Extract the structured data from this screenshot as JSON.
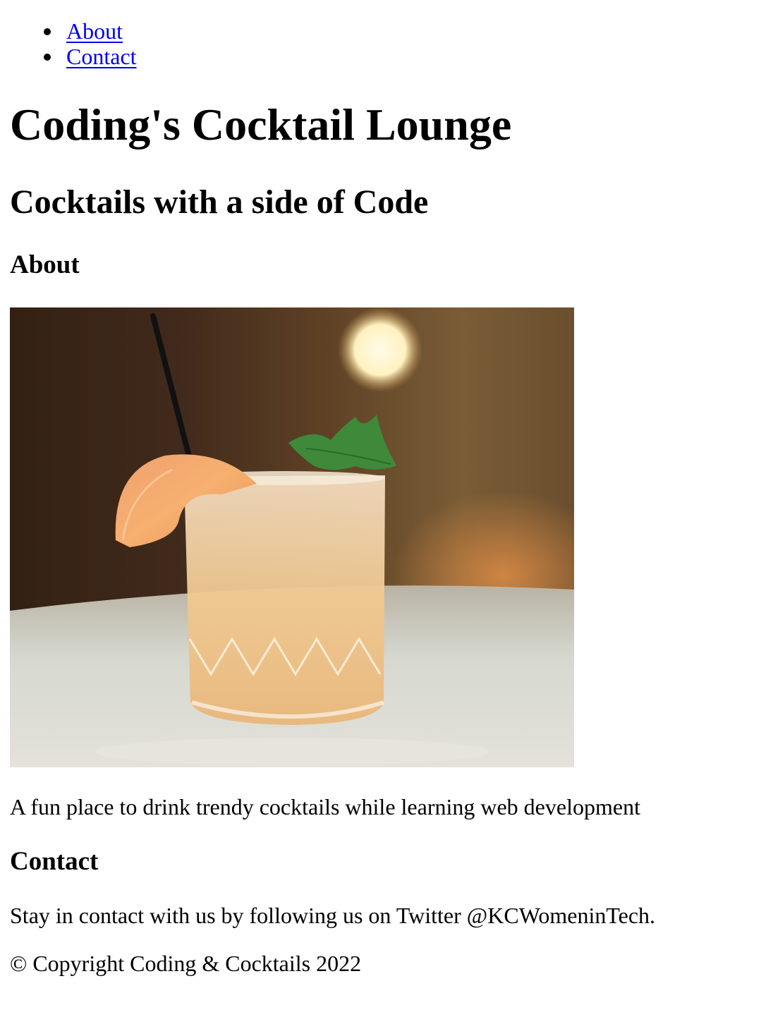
{
  "nav": {
    "items": [
      {
        "label": "About"
      },
      {
        "label": "Contact"
      }
    ]
  },
  "header": {
    "title": "Coding's Cocktail Lounge",
    "subtitle": "Cocktails with a side of Code"
  },
  "about": {
    "heading": "About",
    "image_alt": "Peach cocktail with mint and a straw",
    "text": "A fun place to drink trendy cocktails while learning web development"
  },
  "contact": {
    "heading": "Contact",
    "text": "Stay in contact with us by following us on Twitter @KCWomeninTech."
  },
  "footer": {
    "copyright": "© Copyright Coding & Cocktails 2022"
  },
  "colors": {
    "link": "#0000ee",
    "text": "#000000",
    "background": "#ffffff"
  }
}
